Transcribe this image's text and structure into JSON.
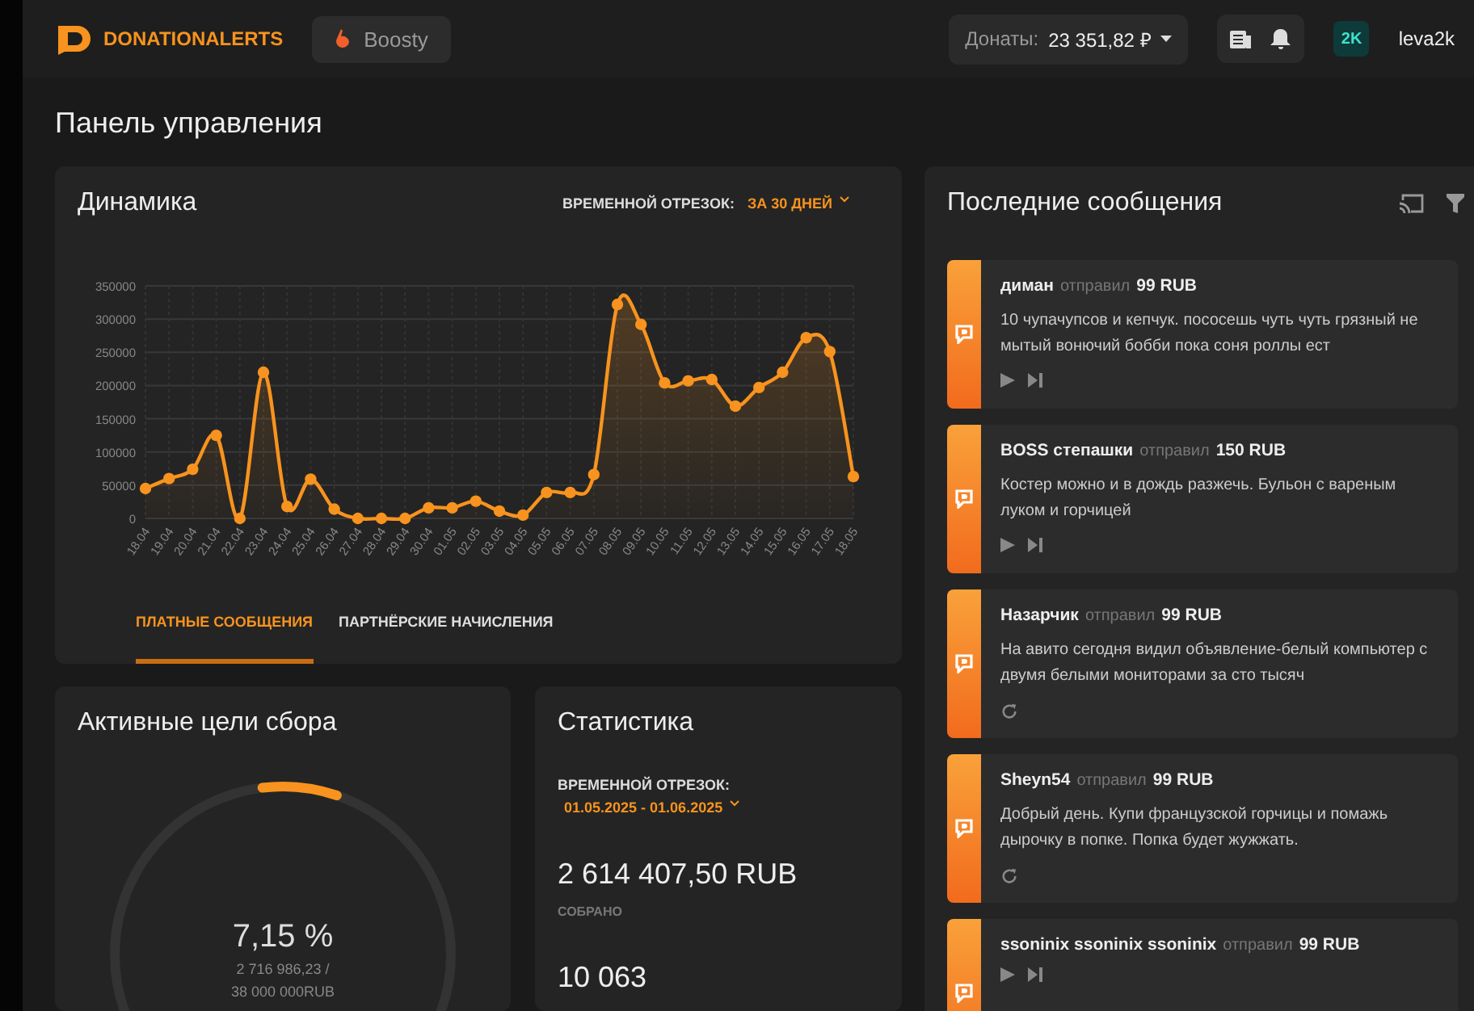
{
  "topbar": {
    "logo": "DONATIONALERTS",
    "boosty": "Boosty",
    "donations": {
      "label": "Донаты:",
      "value": "23 351,82 ₽"
    },
    "user": {
      "initials": "2K",
      "name": "leva2k"
    }
  },
  "page_title": "Панель управления",
  "dynamics": {
    "title": "Динамика",
    "period_label": "ВРЕМЕННОЙ ОТРЕЗОК:",
    "period_value": "ЗА 30 ДНЕЙ",
    "chart_data": {
      "type": "area",
      "categories": [
        "18.04",
        "19.04",
        "20.04",
        "21.04",
        "22.04",
        "23.04",
        "24.04",
        "25.04",
        "26.04",
        "27.04",
        "28.04",
        "29.04",
        "30.04",
        "01.05",
        "02.05",
        "03.05",
        "04.05",
        "05.05",
        "06.05",
        "07.05",
        "08.05",
        "09.05",
        "10.05",
        "11.05",
        "12.05",
        "13.05",
        "14.05",
        "15.05",
        "16.05",
        "17.05",
        "18.05"
      ],
      "grid": true,
      "series": [
        {
          "color": "#f7931e",
          "values": [
            45000,
            60000,
            74000,
            125000,
            0,
            220000,
            18000,
            59000,
            14000,
            0,
            0,
            0,
            16000,
            16000,
            26000,
            11000,
            5000,
            39000,
            39000,
            66000,
            322000,
            292000,
            204000,
            207000,
            209000,
            169000,
            197000,
            220000,
            272000,
            251000,
            63000
          ]
        }
      ],
      "ylim": [
        0,
        350000
      ],
      "yticks": [
        0,
        50000,
        100000,
        150000,
        200000,
        250000,
        300000,
        350000
      ]
    },
    "tabs": [
      {
        "label": "ПЛАТНЫЕ СООБЩЕНИЯ",
        "selected": true
      },
      {
        "label": "ПАРТНЁРСКИЕ НАЧИСЛЕНИЯ",
        "selected": false
      }
    ]
  },
  "goals": {
    "title": "Активные цели сбора",
    "percent": "7,15 %",
    "amount": "2 716 986,23 /",
    "target": "38 000 000RUB",
    "level": 0.0715
  },
  "stats": {
    "title": "Статистика",
    "period_label": "ВРЕМЕННОЙ ОТРЕЗОК:",
    "period_value": "01.05.2025 - 01.06.2025",
    "collected": "2 614 407,50 RUB",
    "collected_label": "СОБРАНО",
    "messages_count": "10 063"
  },
  "messages": {
    "title": "Последние сообщения",
    "items": [
      {
        "name": "диман",
        "verb": "отправил",
        "amount": "99 RUB",
        "text": "10 чупачупсов и кепчук. пососешь чуть чуть грязный не мытый вонючий бобби пока соня роллы ест",
        "kind": "player"
      },
      {
        "name": "BOSS степашки",
        "verb": "отправил",
        "amount": "150 RUB",
        "text": "Костер можно и в дождь разжечь. Бульон с вареным луком и горчицей",
        "kind": "player"
      },
      {
        "name": "Назарчик",
        "verb": "отправил",
        "amount": "99 RUB",
        "text": "На авито сегодня видил объявление-белый компьютер с двумя белыми мониторами за сто тысяч",
        "kind": "replay"
      },
      {
        "name": "Sheyn54",
        "verb": "отправил",
        "amount": "99 RUB",
        "text": "Добрый день. Купи французской горчицы и помажь дырочку в попке. Попка будет жужжать.",
        "kind": "replay"
      },
      {
        "name": "ssoninix ssoninix ssoninix",
        "verb": "отправил",
        "amount": "99 RUB",
        "kind": "player"
      }
    ]
  }
}
